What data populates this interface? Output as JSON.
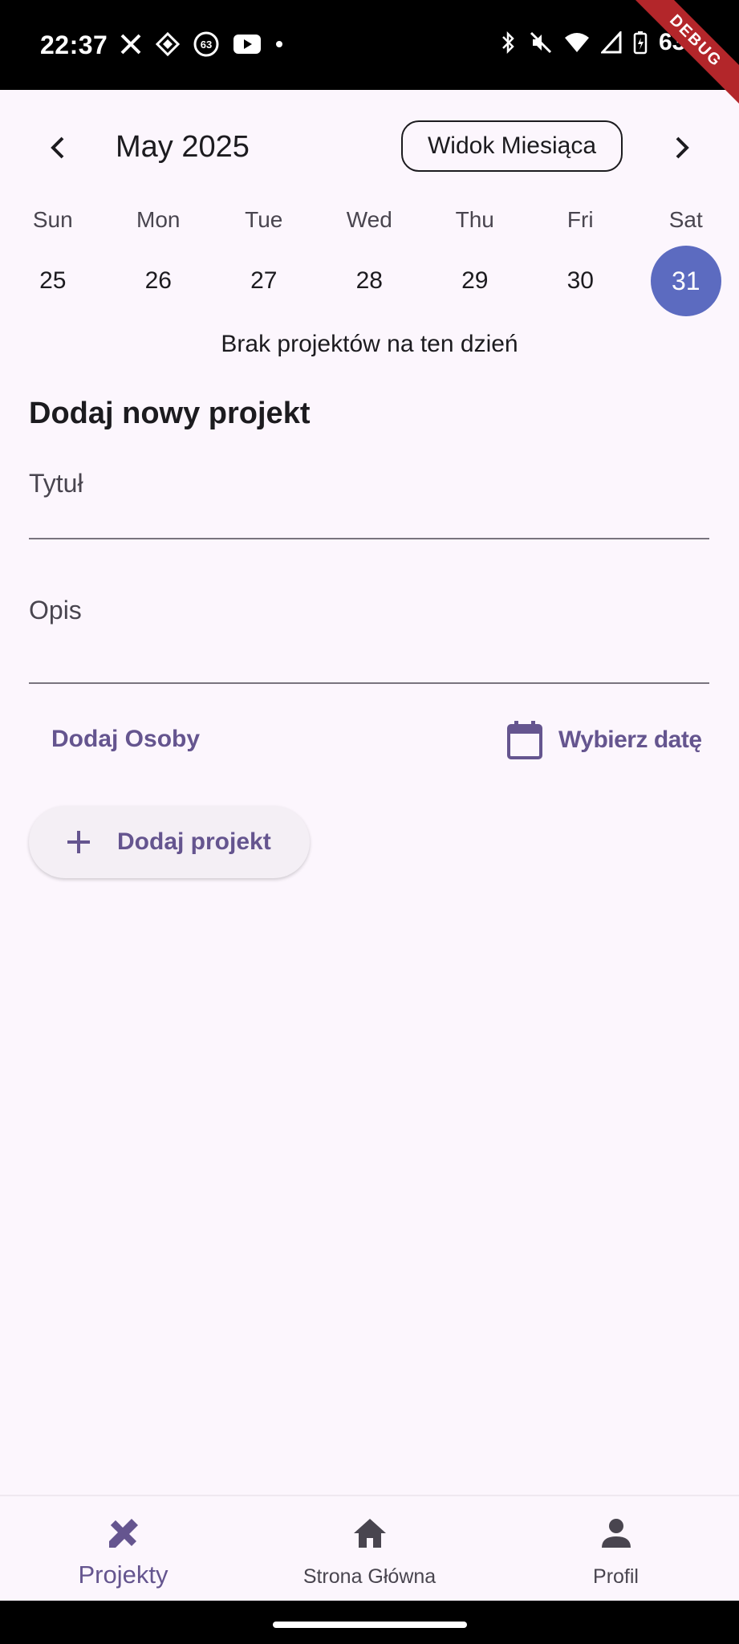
{
  "status_bar": {
    "time": "22:37",
    "battery": "63%",
    "debug_label": "DEBUG",
    "notification_count": "63"
  },
  "calendar": {
    "month_label": "May 2025",
    "view_button": "Widok Miesiąca",
    "weekdays": [
      "Sun",
      "Mon",
      "Tue",
      "Wed",
      "Thu",
      "Fri",
      "Sat"
    ],
    "days": [
      "25",
      "26",
      "27",
      "28",
      "29",
      "30",
      "31"
    ],
    "selected_day": "31",
    "accent_color": "#5c6bc0"
  },
  "empty_state": "Brak projektów na ten dzień",
  "form": {
    "section_title": "Dodaj nowy projekt",
    "title_label": "Tytuł",
    "description_label": "Opis",
    "add_people": "Dodaj Osoby",
    "pick_date": "Wybierz datę",
    "add_project": "Dodaj projekt",
    "accent_color": "#65558f"
  },
  "bottom_nav": {
    "items": [
      {
        "label": "Projekty",
        "icon": "tools-icon",
        "active": true
      },
      {
        "label": "Strona Główna",
        "icon": "home-icon",
        "active": false
      },
      {
        "label": "Profil",
        "icon": "person-icon",
        "active": false
      }
    ]
  }
}
